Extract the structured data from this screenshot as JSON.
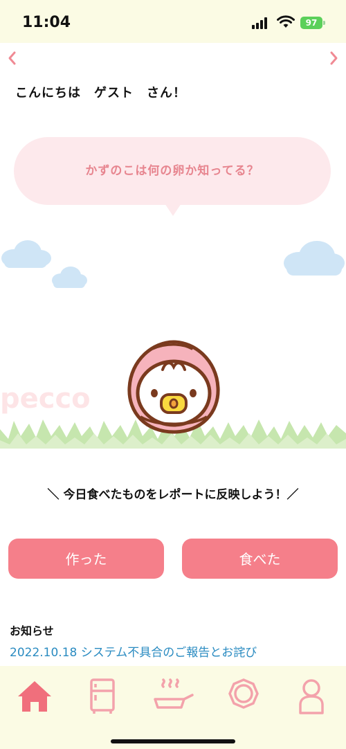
{
  "status": {
    "time": "11:04",
    "battery": "97"
  },
  "nav": {
    "prev_icon": "chevron-left-icon",
    "next_icon": "chevron-right-icon"
  },
  "greeting": "こんにちは　ゲスト　さん！",
  "bubble": {
    "text": "かずのこは何の卵か知ってる？"
  },
  "brand_watermark": "pecco",
  "prompt": "＼ 今日食べたものをレポートに反映しよう！／",
  "buttons": {
    "made": "作った",
    "ate": "食べた"
  },
  "news": {
    "title": "お知らせ",
    "item": "2022.10.18 システム不具合のご報告とお詫び"
  },
  "tabs": [
    {
      "icon": "home-icon",
      "active": true
    },
    {
      "icon": "fridge-icon",
      "active": false
    },
    {
      "icon": "cooking-pan-icon",
      "active": false
    },
    {
      "icon": "plate-icon",
      "active": false
    },
    {
      "icon": "user-icon",
      "active": false
    }
  ],
  "colors": {
    "accent": "#f57f8a",
    "tab_active": "#f06f7c",
    "tab_inactive": "#f3a2ab",
    "link": "#2a8bc1",
    "bar_bg": "#fbfbe4"
  }
}
